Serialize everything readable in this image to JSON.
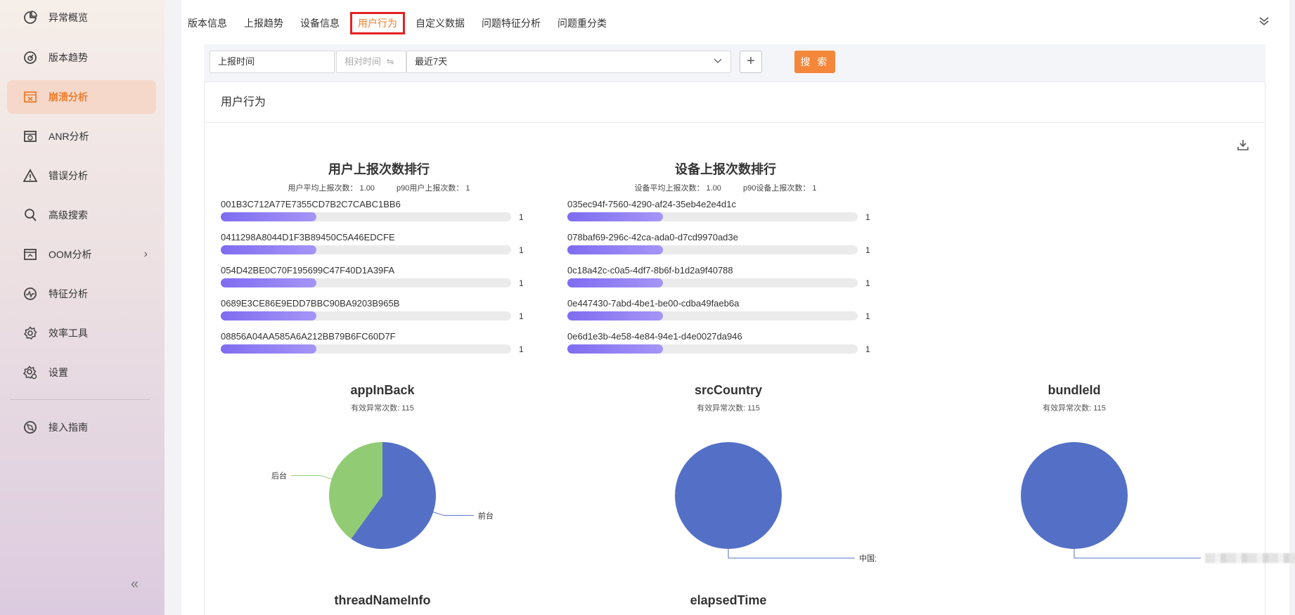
{
  "sidebar": {
    "items": [
      {
        "label": "异常概览",
        "icon": "pie-chart-icon"
      },
      {
        "label": "版本趋势",
        "icon": "gauge-icon"
      },
      {
        "label": "崩溃分析",
        "icon": "crash-icon",
        "active": true
      },
      {
        "label": "ANR分析",
        "icon": "window-icon"
      },
      {
        "label": "错误分析",
        "icon": "warning-icon"
      },
      {
        "label": "高级搜索",
        "icon": "search-icon"
      },
      {
        "label": "OOM分析",
        "icon": "memory-icon",
        "has_submenu": true
      },
      {
        "label": "特征分析",
        "icon": "pulse-icon"
      },
      {
        "label": "效率工具",
        "icon": "gear-icon"
      },
      {
        "label": "设置",
        "icon": "settings-icon"
      }
    ],
    "bottom_item": {
      "label": "接入指南",
      "icon": "compass-icon"
    }
  },
  "tabs": [
    {
      "label": "版本信息"
    },
    {
      "label": "上报趋势"
    },
    {
      "label": "设备信息"
    },
    {
      "label": "用户行为",
      "active": true
    },
    {
      "label": "自定义数据"
    },
    {
      "label": "问题特征分析"
    },
    {
      "label": "问题重分类"
    }
  ],
  "filter": {
    "field": "上报时间",
    "mode": "相对时间",
    "range": "最近7天",
    "search_label": "搜 索"
  },
  "card": {
    "title": "用户行为"
  },
  "user_rank": {
    "title": "用户上报次数排行",
    "avg_label": "用户平均上报次数：",
    "avg_value": "1.00",
    "p90_label": "p90用户上报次数：",
    "p90_value": "1",
    "rows": [
      {
        "id": "001B3C712A77E7355CD7B2C7CABC1BB6",
        "value": "1"
      },
      {
        "id": "0411298A8044D1F3B89450C5A46EDCFE",
        "value": "1"
      },
      {
        "id": "054D42BE0C70F195699C47F40D1A39FA",
        "value": "1"
      },
      {
        "id": "0689E3CE86E9EDD7BBC90BA9203B965B",
        "value": "1"
      },
      {
        "id": "08856A04AA585A6A212BB79B6FC60D7F",
        "value": "1"
      }
    ]
  },
  "device_rank": {
    "title": "设备上报次数排行",
    "avg_label": "设备平均上报次数：",
    "avg_value": "1.00",
    "p90_label": "p90设备上报次数：",
    "p90_value": "1",
    "rows": [
      {
        "id": "035ec94f-7560-4290-af24-35eb4e2e4d1c",
        "value": "1"
      },
      {
        "id": "078baf69-296c-42ca-ada0-d7cd9970ad3e",
        "value": "1"
      },
      {
        "id": "0c18a42c-c0a5-4df7-8b6f-b1d2a9f40788",
        "value": "1"
      },
      {
        "id": "0e447430-7abd-4be1-be00-cdba49faeb6a",
        "value": "1"
      },
      {
        "id": "0e6d1e3b-4e58-4e84-94e1-d4e0027da946",
        "value": "1"
      }
    ]
  },
  "bar_fill_fraction": 0.33,
  "chart_data": [
    {
      "type": "pie",
      "title": "appInBack",
      "subtitle": "有效异常次数: 115",
      "slices": [
        {
          "label": "前台",
          "value": 69,
          "color": "#5470c6"
        },
        {
          "label": "后台",
          "value": 46,
          "color": "#91cc75"
        }
      ]
    },
    {
      "type": "pie",
      "title": "srcCountry",
      "subtitle": "有效异常次数: 115",
      "slices": [
        {
          "label": "中国大陆",
          "value": 115,
          "color": "#5470c6"
        }
      ]
    },
    {
      "type": "pie",
      "title": "bundleId",
      "subtitle": "有效异常次数: 115",
      "slices": [
        {
          "label": "",
          "value": 115,
          "color": "#5470c6"
        }
      ]
    }
  ],
  "bottom_titles": [
    "threadNameInfo",
    "elapsedTime"
  ]
}
